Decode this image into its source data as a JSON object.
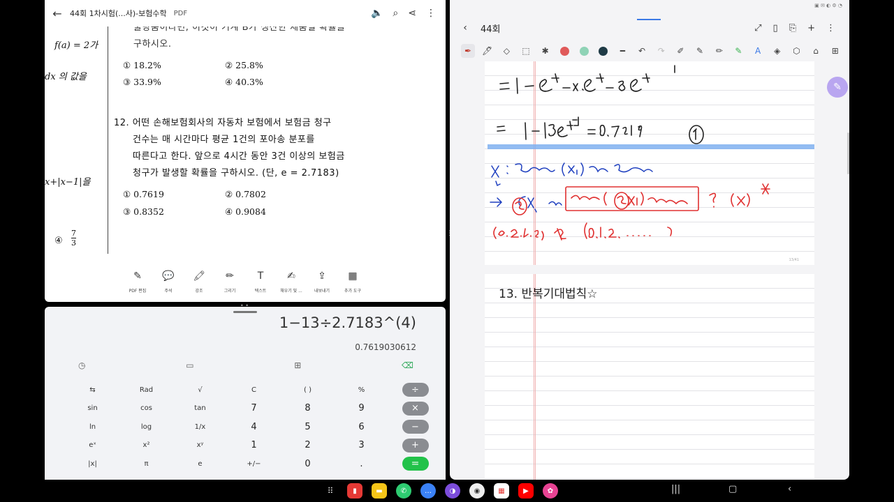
{
  "pdf": {
    "title": "44회 1차시험(...사)-보험수학",
    "tag": "PDF",
    "left_margin": [
      "f(a) = 2가",
      "dx 의  값을",
      "x+|x−1|을"
    ],
    "left_option4": "④",
    "left_fraction_num": "7",
    "left_fraction_den": "3",
    "q11_tail": [
      "불량품이라면, 이것이 기계 B가 생산한 제품일 확률을",
      "구하시오."
    ],
    "q11_options": [
      "① 18.2%",
      "② 25.8%",
      "③ 33.9%",
      "④ 40.3%"
    ],
    "q12_lines": [
      "12. 어떤 손해보험회사의 자동차 보험에서 보험금 청구",
      "건수는 매 시간마다 평균 1건의 포아송 분포를",
      "따른다고 한다. 앞으로 4시간 동안 3건 이상의 보험금",
      "청구가 발생할 확률을 구하시오. (단, e = 2.7183)"
    ],
    "q12_options": [
      "① 0.7619",
      "② 0.7802",
      "③ 0.8352",
      "④ 0.9084"
    ],
    "tools": [
      {
        "icon": "✎",
        "label": "PDF 편집"
      },
      {
        "icon": "💬",
        "label": "주석"
      },
      {
        "icon": "🖍",
        "label": "강조"
      },
      {
        "icon": "✏",
        "label": "그리기"
      },
      {
        "icon": "T",
        "label": "텍스트"
      },
      {
        "icon": "✍",
        "label": "채우기 및 ..."
      },
      {
        "icon": "⇪",
        "label": "내보내기"
      },
      {
        "icon": "▦",
        "label": "추가 도구"
      }
    ]
  },
  "calculator": {
    "expression": "1−13÷2.7183^(4)",
    "result": "0.7619030612",
    "rows": [
      [
        "⇆",
        "Rad",
        "√",
        "C",
        "( )",
        "%",
        "÷"
      ],
      [
        "sin",
        "cos",
        "tan",
        "7",
        "8",
        "9",
        "×"
      ],
      [
        "ln",
        "log",
        "1/x",
        "4",
        "5",
        "6",
        "−"
      ],
      [
        "eˣ",
        "x²",
        "xʸ",
        "1",
        "2",
        "3",
        "+"
      ],
      [
        "|x|",
        "π",
        "e",
        "+/−",
        "0",
        ".",
        "="
      ]
    ]
  },
  "notes": {
    "title": "44회",
    "page1_number": "13/41",
    "heading": "13. 반복기대법칙☆",
    "ink_color_red": "#e03030",
    "ink_color_blue": "#1e3fbf"
  }
}
